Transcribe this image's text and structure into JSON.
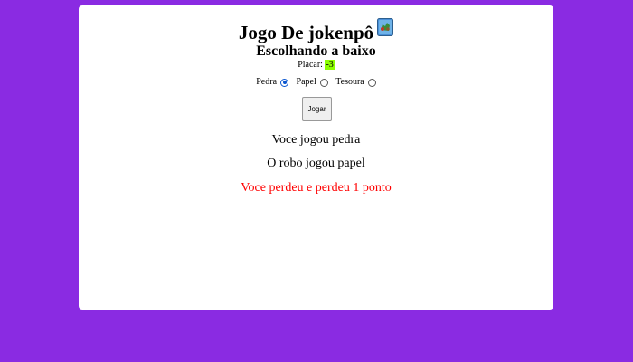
{
  "page": {
    "background_color": "#8a2be2",
    "card_color": "#ffffff"
  },
  "header": {
    "title": "Jogo De jokenpô",
    "title_icon": "rock-paper-scissors-icon",
    "subtitle": "Escolhando a baixo"
  },
  "score": {
    "label": "Placar:",
    "value": "-3",
    "highlight_color": "#8cff00"
  },
  "choices": [
    {
      "label": "Pedra",
      "checked": true
    },
    {
      "label": "Papel",
      "checked": false
    },
    {
      "label": "Tesoura",
      "checked": false
    }
  ],
  "play_button": {
    "label": "Jogar"
  },
  "results": {
    "player": "Voce jogou pedra",
    "robot": "O robo jogou papel",
    "outcome": "Voce perdeu e perdeu 1 ponto",
    "outcome_color": "#ff0000"
  }
}
